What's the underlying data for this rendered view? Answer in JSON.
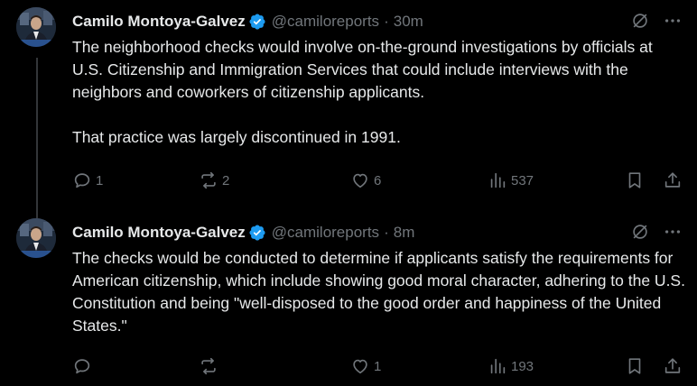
{
  "tweets": [
    {
      "author_name": "Camilo Montoya-Galvez",
      "handle": "@camiloreports",
      "separator": "·",
      "time": "30m",
      "text": "The neighborhood checks would involve on-the-ground investigations by officials at U.S. Citizenship and Immigration Services that could include interviews with the neighbors and coworkers of citizenship applicants.\n\nThat practice was largely discontinued in 1991.",
      "replies": "1",
      "reposts": "2",
      "likes": "6",
      "views": "537"
    },
    {
      "author_name": "Camilo Montoya-Galvez",
      "handle": "@camiloreports",
      "separator": "·",
      "time": "8m",
      "text": "The checks would be conducted to determine if applicants satisfy the requirements for American citizenship, which include showing good moral character, adhering to the U.S. Constitution and being \"well-disposed to the good order and happiness of the United States.\"",
      "replies": "",
      "reposts": "",
      "likes": "1",
      "views": "193"
    }
  ],
  "icons": {
    "verified": "verified-badge-icon",
    "grok": "slashed-circle-icon",
    "more": "more-dots-icon",
    "reply": "reply-icon",
    "repost": "repost-icon",
    "like": "heart-icon",
    "views": "views-bar-icon",
    "bookmark": "bookmark-icon",
    "share": "share-icon"
  },
  "colors": {
    "background": "#000000",
    "text": "#e7e9ea",
    "muted": "#71767b",
    "verified": "#1d9bf0",
    "thread_line": "#333639"
  }
}
